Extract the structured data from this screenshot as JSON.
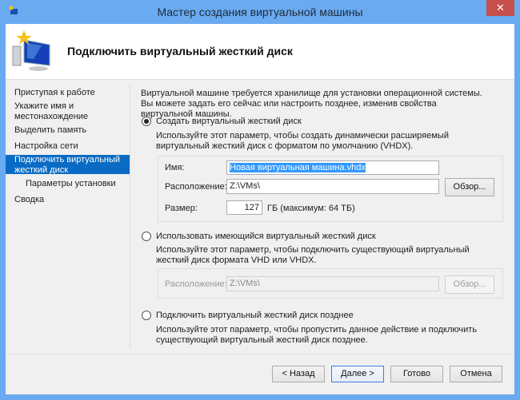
{
  "window": {
    "title": "Мастер создания виртуальной машины",
    "close": "✕"
  },
  "header": {
    "title": "Подключить виртуальный жесткий диск"
  },
  "nav": {
    "items": [
      {
        "label": "Приступая к работе"
      },
      {
        "label": "Укажите имя и местонахождение"
      },
      {
        "label": "Выделить память"
      },
      {
        "label": "Настройка сети"
      },
      {
        "label": "Подключить виртуальный жесткий диск",
        "selected": true
      },
      {
        "label": "Параметры установки"
      },
      {
        "label": "Сводка"
      }
    ]
  },
  "main": {
    "intro": "Виртуальной машине требуется хранилище для установки операционной системы. Вы можете задать его сейчас или настроить позднее, изменив свойства виртуальной машины.",
    "option_create": {
      "label": "Создать виртуальный жесткий диск",
      "selected": true,
      "desc": "Используйте этот параметр, чтобы создать динамически расширяемый виртуальный жесткий диск с форматом по умолчанию (VHDX).",
      "name_label": "Имя:",
      "name_value": "Новая виртуальная машина.vhdx",
      "location_label": "Расположение:",
      "location_value": "Z:\\VMs\\",
      "browse": "Обзор...",
      "size_label": "Размер:",
      "size_value": "127",
      "size_hint": "ГБ (максимум: 64 ТБ)"
    },
    "option_existing": {
      "label": "Использовать имеющийся виртуальный жесткий диск",
      "selected": false,
      "desc": "Используйте этот параметр, чтобы подключить существующий виртуальный жесткий диск формата VHD или VHDX.",
      "location_label": "Расположение:",
      "location_value": "Z:\\VMs\\",
      "browse": "Обзор..."
    },
    "option_later": {
      "label": "Подключить виртуальный жесткий диск позднее",
      "selected": false,
      "desc": "Используйте этот параметр, чтобы пропустить данное действие и подключить существующий виртуальный жесткий диск позднее."
    }
  },
  "buttons": {
    "back": "< Назад",
    "next": "Далее >",
    "finish": "Готово",
    "cancel": "Отмена"
  },
  "colors": {
    "titlebar": "#6aaaf0",
    "selection": "#0a6bc4",
    "close": "#c7504c"
  }
}
